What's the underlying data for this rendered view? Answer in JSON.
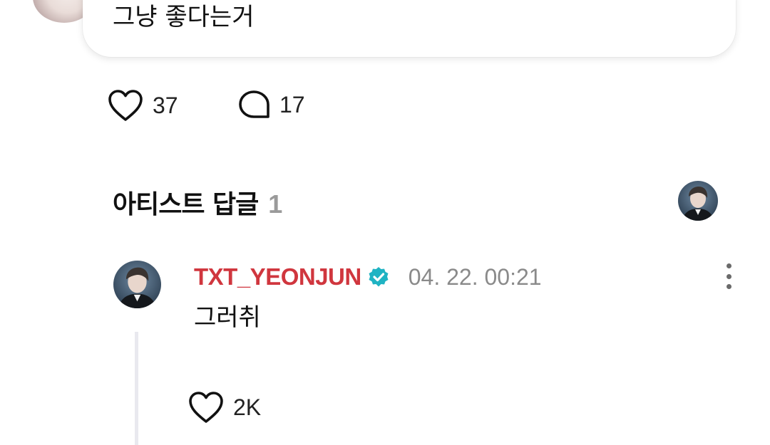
{
  "post": {
    "text": "그냥 좋다는거",
    "likes": "37",
    "comments": "17"
  },
  "artist_replies": {
    "title": "아티스트 답글",
    "count": "1"
  },
  "reply": {
    "author": "TXT_YEONJUN",
    "timestamp": "04. 22. 00:21",
    "text": "그러취",
    "likes": "2K"
  },
  "icons": {
    "like": "heart-outline-icon",
    "comment": "speech-bubble-icon",
    "verified": "verified-badge-icon",
    "more": "more-vertical-icon"
  },
  "colors": {
    "author_name": "#d0363e",
    "verified_badge": "#1fb3c3",
    "count_gray": "#9a9a9a",
    "timestamp_gray": "#8a8a8a"
  }
}
